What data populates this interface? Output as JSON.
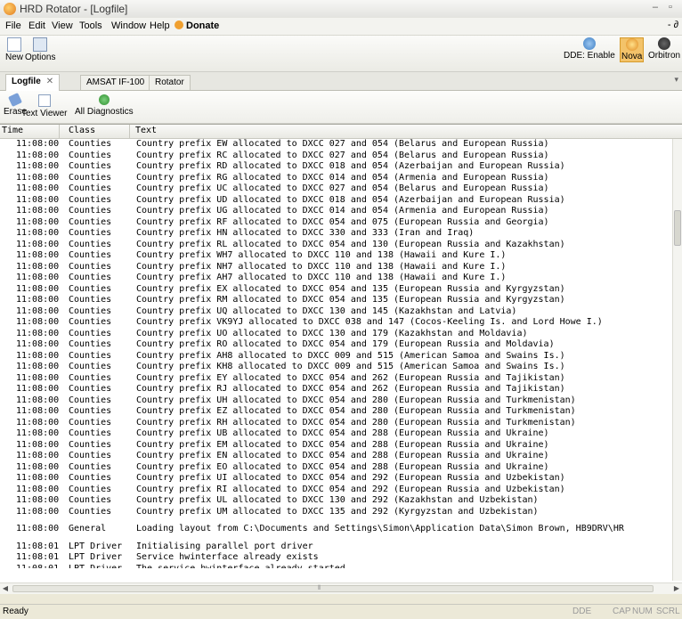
{
  "window": {
    "title": "HRD Rotator - [Logfile]",
    "min": "–",
    "max": "▫"
  },
  "menu": {
    "items": [
      {
        "key": "file",
        "label": "File"
      },
      {
        "key": "edit",
        "label": "Edit"
      },
      {
        "key": "view",
        "label": "View"
      },
      {
        "key": "tools",
        "label": "Tools"
      },
      {
        "key": "window",
        "label": "Window"
      },
      {
        "key": "help",
        "label": "Help"
      }
    ],
    "donate": "Donate",
    "restore": "- ∂"
  },
  "toolbar": {
    "new": "New",
    "options": "Options",
    "dde_enable": "DDE: Enable",
    "nova": "Nova",
    "orbitron": "Orbitron"
  },
  "tabs": [
    {
      "label": "Logfile",
      "close": "✕",
      "active": true
    },
    {
      "label": "AMSAT IF-100",
      "active": false
    },
    {
      "label": "Rotator",
      "active": false
    }
  ],
  "subtoolbar": {
    "erase": "Erase",
    "text_viewer": "Text Viewer",
    "all_diagnostics": "All Diagnostics"
  },
  "columns": {
    "time": "Time",
    "class": "Class",
    "text": "Text"
  },
  "rows": [
    {
      "time": "11:08:00",
      "class": "Counties",
      "text": "Country prefix EW allocated to DXCC 027 and 054 (Belarus and European Russia)"
    },
    {
      "time": "11:08:00",
      "class": "Counties",
      "text": "Country prefix RC allocated to DXCC 027 and 054 (Belarus and European Russia)"
    },
    {
      "time": "11:08:00",
      "class": "Counties",
      "text": "Country prefix RD allocated to DXCC 018 and 054 (Azerbaijan and European Russia)"
    },
    {
      "time": "11:08:00",
      "class": "Counties",
      "text": "Country prefix RG allocated to DXCC 014 and 054 (Armenia and European Russia)"
    },
    {
      "time": "11:08:00",
      "class": "Counties",
      "text": "Country prefix UC allocated to DXCC 027 and 054 (Belarus and European Russia)"
    },
    {
      "time": "11:08:00",
      "class": "Counties",
      "text": "Country prefix UD allocated to DXCC 018 and 054 (Azerbaijan and European Russia)"
    },
    {
      "time": "11:08:00",
      "class": "Counties",
      "text": "Country prefix UG allocated to DXCC 014 and 054 (Armenia and European Russia)"
    },
    {
      "time": "11:08:00",
      "class": "Counties",
      "text": "Country prefix RF allocated to DXCC 054 and 075 (European Russia and Georgia)"
    },
    {
      "time": "11:08:00",
      "class": "Counties",
      "text": "Country prefix HN allocated to DXCC 330 and 333 (Iran and Iraq)"
    },
    {
      "time": "11:08:00",
      "class": "Counties",
      "text": "Country prefix RL allocated to DXCC 054 and 130 (European Russia and Kazakhstan)"
    },
    {
      "time": "11:08:00",
      "class": "Counties",
      "text": "Country prefix WH7 allocated to DXCC 110 and 138 (Hawaii and Kure I.)"
    },
    {
      "time": "11:08:00",
      "class": "Counties",
      "text": "Country prefix NH7 allocated to DXCC 110 and 138 (Hawaii and Kure I.)"
    },
    {
      "time": "11:08:00",
      "class": "Counties",
      "text": "Country prefix AH7 allocated to DXCC 110 and 138 (Hawaii and Kure I.)"
    },
    {
      "time": "11:08:00",
      "class": "Counties",
      "text": "Country prefix EX allocated to DXCC 054 and 135 (European Russia and Kyrgyzstan)"
    },
    {
      "time": "11:08:00",
      "class": "Counties",
      "text": "Country prefix RM allocated to DXCC 054 and 135 (European Russia and Kyrgyzstan)"
    },
    {
      "time": "11:08:00",
      "class": "Counties",
      "text": "Country prefix UQ allocated to DXCC 130 and 145 (Kazakhstan and Latvia)"
    },
    {
      "time": "11:08:00",
      "class": "Counties",
      "text": "Country prefix VK9YJ allocated to DXCC 038 and 147 (Cocos-Keeling Is. and Lord Howe I.)"
    },
    {
      "time": "11:08:00",
      "class": "Counties",
      "text": "Country prefix UO allocated to DXCC 130 and 179 (Kazakhstan and Moldavia)"
    },
    {
      "time": "11:08:00",
      "class": "Counties",
      "text": "Country prefix RO allocated to DXCC 054 and 179 (European Russia and Moldavia)"
    },
    {
      "time": "11:08:00",
      "class": "Counties",
      "text": "Country prefix AH8 allocated to DXCC 009 and 515 (American Samoa and Swains Is.)"
    },
    {
      "time": "11:08:00",
      "class": "Counties",
      "text": "Country prefix KH8 allocated to DXCC 009 and 515 (American Samoa and Swains Is.)"
    },
    {
      "time": "11:08:00",
      "class": "Counties",
      "text": "Country prefix EY allocated to DXCC 054 and 262 (European Russia and Tajikistan)"
    },
    {
      "time": "11:08:00",
      "class": "Counties",
      "text": "Country prefix RJ allocated to DXCC 054 and 262 (European Russia and Tajikistan)"
    },
    {
      "time": "11:08:00",
      "class": "Counties",
      "text": "Country prefix UH allocated to DXCC 054 and 280 (European Russia and Turkmenistan)"
    },
    {
      "time": "11:08:00",
      "class": "Counties",
      "text": "Country prefix EZ allocated to DXCC 054 and 280 (European Russia and Turkmenistan)"
    },
    {
      "time": "11:08:00",
      "class": "Counties",
      "text": "Country prefix RH allocated to DXCC 054 and 280 (European Russia and Turkmenistan)"
    },
    {
      "time": "11:08:00",
      "class": "Counties",
      "text": "Country prefix UB allocated to DXCC 054 and 288 (European Russia and Ukraine)"
    },
    {
      "time": "11:08:00",
      "class": "Counties",
      "text": "Country prefix EM allocated to DXCC 054 and 288 (European Russia and Ukraine)"
    },
    {
      "time": "11:08:00",
      "class": "Counties",
      "text": "Country prefix EN allocated to DXCC 054 and 288 (European Russia and Ukraine)"
    },
    {
      "time": "11:08:00",
      "class": "Counties",
      "text": "Country prefix EO allocated to DXCC 054 and 288 (European Russia and Ukraine)"
    },
    {
      "time": "11:08:00",
      "class": "Counties",
      "text": "Country prefix UI allocated to DXCC 054 and 292 (European Russia and Uzbekistan)"
    },
    {
      "time": "11:08:00",
      "class": "Counties",
      "text": "Country prefix RI allocated to DXCC 054 and 292 (European Russia and Uzbekistan)"
    },
    {
      "time": "11:08:00",
      "class": "Counties",
      "text": "Country prefix UL allocated to DXCC 130 and 292 (Kazakhstan and Uzbekistan)"
    },
    {
      "time": "11:08:00",
      "class": "Counties",
      "text": "Country prefix UM allocated to DXCC 135 and 292 (Kyrgyzstan and Uzbekistan)"
    },
    {
      "gap": true
    },
    {
      "time": "11:08:00",
      "class": "General",
      "text": "Loading layout from C:\\Documents and Settings\\Simon\\Application Data\\Simon Brown, HB9DRV\\HR"
    },
    {
      "gap": true
    },
    {
      "time": "11:08:01",
      "class": "LPT Driver",
      "text": "Initialising parallel port driver"
    },
    {
      "time": "11:08:01",
      "class": "LPT Driver",
      "text": "Service hwinterface already exists"
    },
    {
      "time": "11:08:01",
      "class": "LPT Driver",
      "text": "The service hwinterface already started"
    }
  ],
  "status": {
    "text": "Ready",
    "ind1": "DDE",
    "ind2": "CAP",
    "ind3": "NUM",
    "ind4": "SCRL"
  }
}
